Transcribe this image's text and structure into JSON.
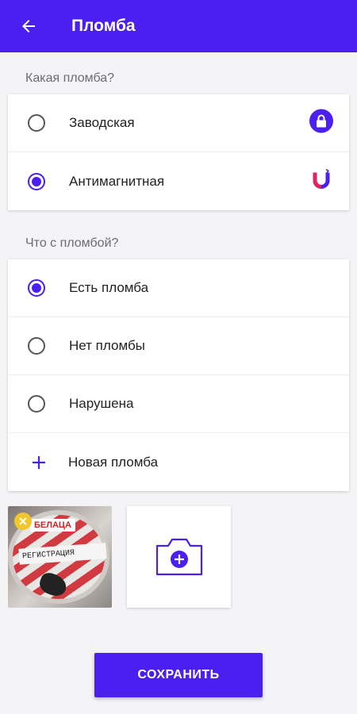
{
  "appbar": {
    "title": "Пломба",
    "back_icon": "arrow-left-icon"
  },
  "seal_type": {
    "label": "Какая пломба?",
    "options": [
      {
        "label": "Заводская",
        "selected": false,
        "icon": "lock-icon"
      },
      {
        "label": "Антимагнитная",
        "selected": true,
        "icon": "magnet-icon"
      }
    ]
  },
  "seal_state": {
    "label": "Что с пломбой?",
    "options": [
      {
        "label": "Есть пломба",
        "selected": true
      },
      {
        "label": "Нет пломбы",
        "selected": false
      },
      {
        "label": "Нарушена",
        "selected": false
      }
    ],
    "add_label": "Новая пломба"
  },
  "photos": {
    "thumbnail_logo": "БЕЛАЦА",
    "thumbnail_text": "РЕГИСТРАЦИЯ",
    "add_icon": "camera-add-icon"
  },
  "save_label": "СОХРАНИТЬ",
  "colors": {
    "accent": "#4a1ff0",
    "badge": "#f2c72b",
    "magnet_red": "#e0245e"
  }
}
